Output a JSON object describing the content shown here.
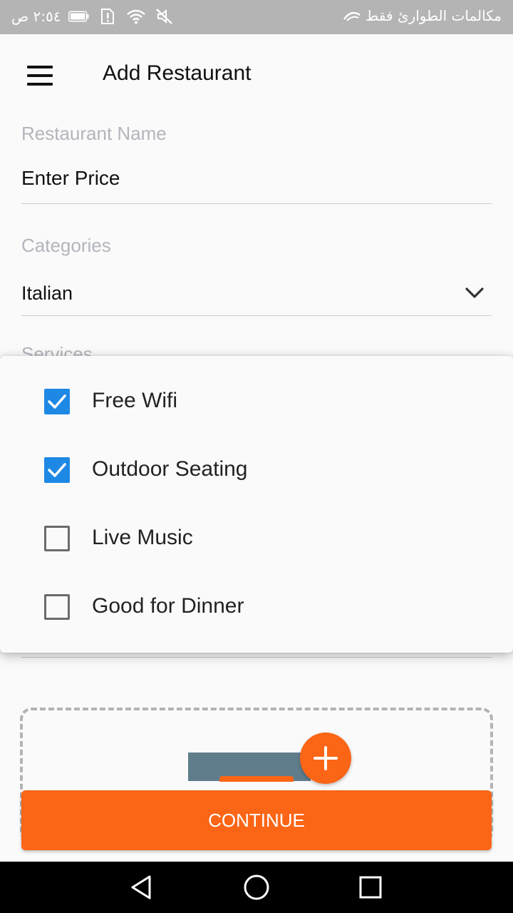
{
  "status_bar": {
    "time": "٢:٥٤ ص",
    "carrier": "مكالمات الطوارئ فقط",
    "icons": [
      "battery-icon",
      "sim-alert-icon",
      "wifi-icon",
      "mute-icon",
      "carrier-signal-icon"
    ]
  },
  "app_bar": {
    "title": "Add Restaurant",
    "menu_icon": "hamburger-menu-icon"
  },
  "form": {
    "name_label": "Restaurant Name",
    "name_value": "Enter Price",
    "categories_label": "Categories",
    "categories_value": "Italian",
    "services_label": "Services"
  },
  "services_popup": {
    "options": [
      {
        "label": "Free Wifi",
        "checked": true
      },
      {
        "label": "Outdoor Seating",
        "checked": true
      },
      {
        "label": "Live Music",
        "checked": false
      },
      {
        "label": "Good for Dinner",
        "checked": false
      }
    ]
  },
  "upload": {
    "add_icon": "plus-icon"
  },
  "continue_label": "CONTINUE",
  "nav": {
    "icons": [
      "back-icon",
      "home-icon",
      "recents-icon"
    ]
  },
  "colors": {
    "accent": "#fb6516",
    "checkbox": "#1e88e5",
    "label_gray": "#b3b5bc",
    "status_bar": "#b4b4b4",
    "thumbnail": "#607d8b"
  }
}
